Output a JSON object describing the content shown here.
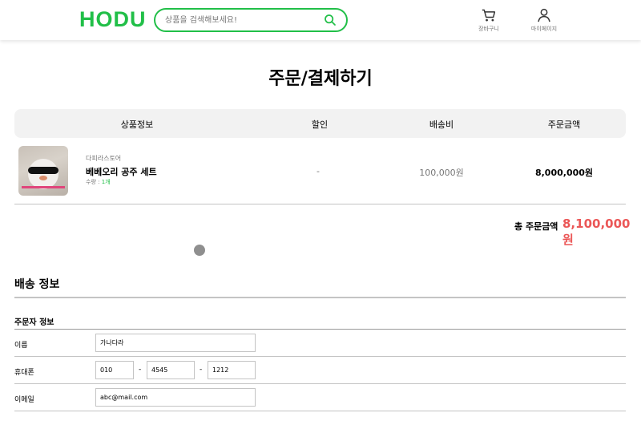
{
  "header": {
    "logo": "HODU",
    "search_placeholder": "상품을 검색해보세요!",
    "cart_label": "장바구니",
    "mypage_label": "마이페이지"
  },
  "page": {
    "title": "주문/결제하기"
  },
  "table": {
    "headers": {
      "product": "상품정보",
      "discount": "할인",
      "shipping": "배송비",
      "total": "주문금액"
    },
    "rows": [
      {
        "store": "다피라스토어",
        "name": "베베오리 공주 세트",
        "qty_label": "수량 : ",
        "qty_value": "1개",
        "discount": "-",
        "shipping": "100,000원",
        "total": "8,000,000원"
      }
    ]
  },
  "summary": {
    "label": "총 주문금액",
    "value": "8,100,000원"
  },
  "delivery": {
    "title": "배송 정보",
    "orderer_title": "주문자 정보",
    "name_label": "이름",
    "name_value": "가나다라",
    "phone_label": "휴대폰",
    "phone": [
      "010",
      "4545",
      "1212"
    ],
    "phone_sep": "-",
    "email_label": "이메일",
    "email_value": "abc@mail.com"
  },
  "colors": {
    "accent": "#21bf48",
    "price": "#eb5757"
  }
}
